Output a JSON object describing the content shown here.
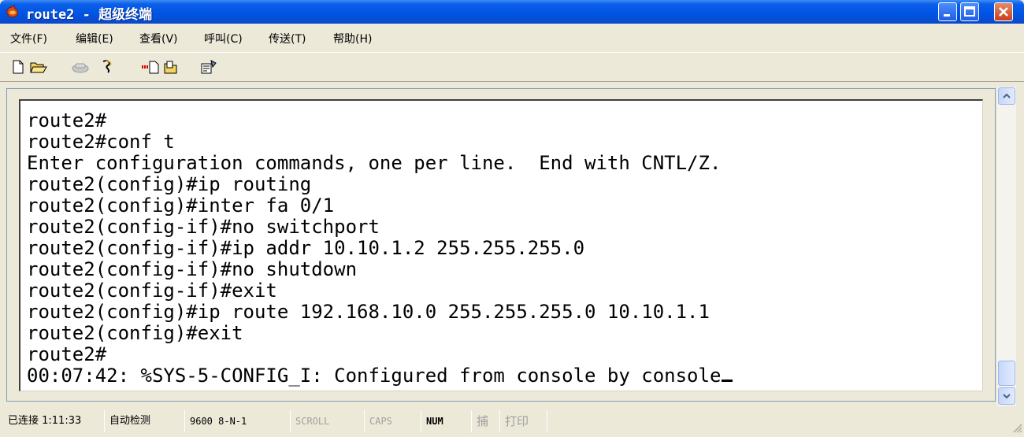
{
  "window": {
    "title": "route2 - 超级终端"
  },
  "menu": [
    {
      "label": "文件(F)"
    },
    {
      "label": "编辑(E)"
    },
    {
      "label": "查看(V)"
    },
    {
      "label": "呼叫(C)"
    },
    {
      "label": "传送(T)"
    },
    {
      "label": "帮助(H)"
    }
  ],
  "toolbar": [
    "new-icon",
    "open-icon",
    "disconnect-icon",
    "dial-icon",
    "send-icon",
    "receive-icon",
    "properties-icon"
  ],
  "terminal": {
    "lines": [
      "route2#",
      "route2#conf t",
      "Enter configuration commands, one per line.  End with CNTL/Z.",
      "route2(config)#ip routing",
      "route2(config)#inter fa 0/1",
      "route2(config-if)#no switchport",
      "route2(config-if)#ip addr 10.10.1.2 255.255.255.0",
      "route2(config-if)#no shutdown",
      "route2(config-if)#exit",
      "route2(config)#ip route 192.168.10.0 255.255.255.0 10.10.1.1",
      "route2(config)#exit",
      "route2#",
      "00:07:42: %SYS-5-CONFIG_I: Configured from console by console"
    ]
  },
  "status": {
    "connected": "已连接 1:11:33",
    "detect": "自动检测",
    "baud": "9600 8-N-1",
    "scroll": "SCROLL",
    "caps": "CAPS",
    "num": "NUM",
    "capture": "捕",
    "print": "打印"
  },
  "colors": {
    "titlebar": "#0054e3",
    "face": "#ece9d8",
    "close": "#c9401a"
  }
}
